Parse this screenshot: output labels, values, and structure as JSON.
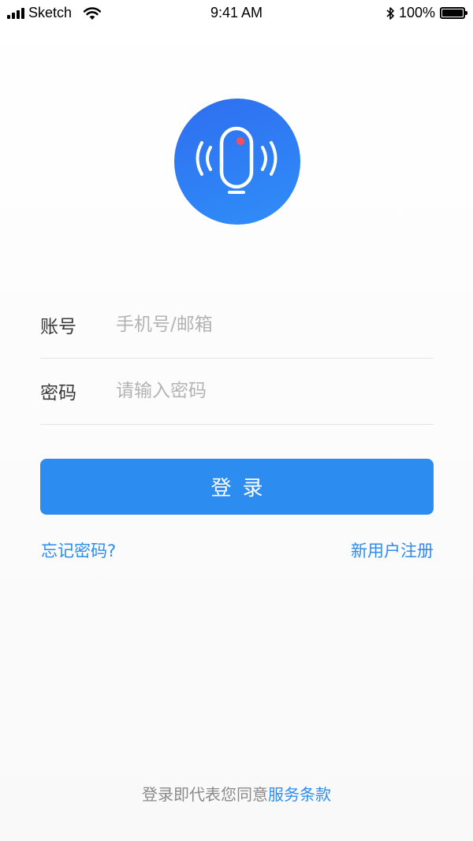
{
  "status_bar": {
    "carrier": "Sketch",
    "time": "9:41 AM",
    "battery": "100%"
  },
  "colors": {
    "primary": "#2d8cf0",
    "logo_gradient_start": "#2f6ef0",
    "logo_gradient_end": "#2f8ef8",
    "logo_dot": "#f5505a"
  },
  "logo": {
    "icon": "microphone-icon"
  },
  "form": {
    "account_label": "账号",
    "account_placeholder": "手机号/邮箱",
    "account_value": "",
    "password_label": "密码",
    "password_placeholder": "请输入密码",
    "password_value": ""
  },
  "login_button": "登录",
  "links": {
    "forgot": "忘记密码?",
    "register": "新用户注册"
  },
  "terms": {
    "prefix": "登录即代表您同意",
    "link": "服务条款"
  }
}
